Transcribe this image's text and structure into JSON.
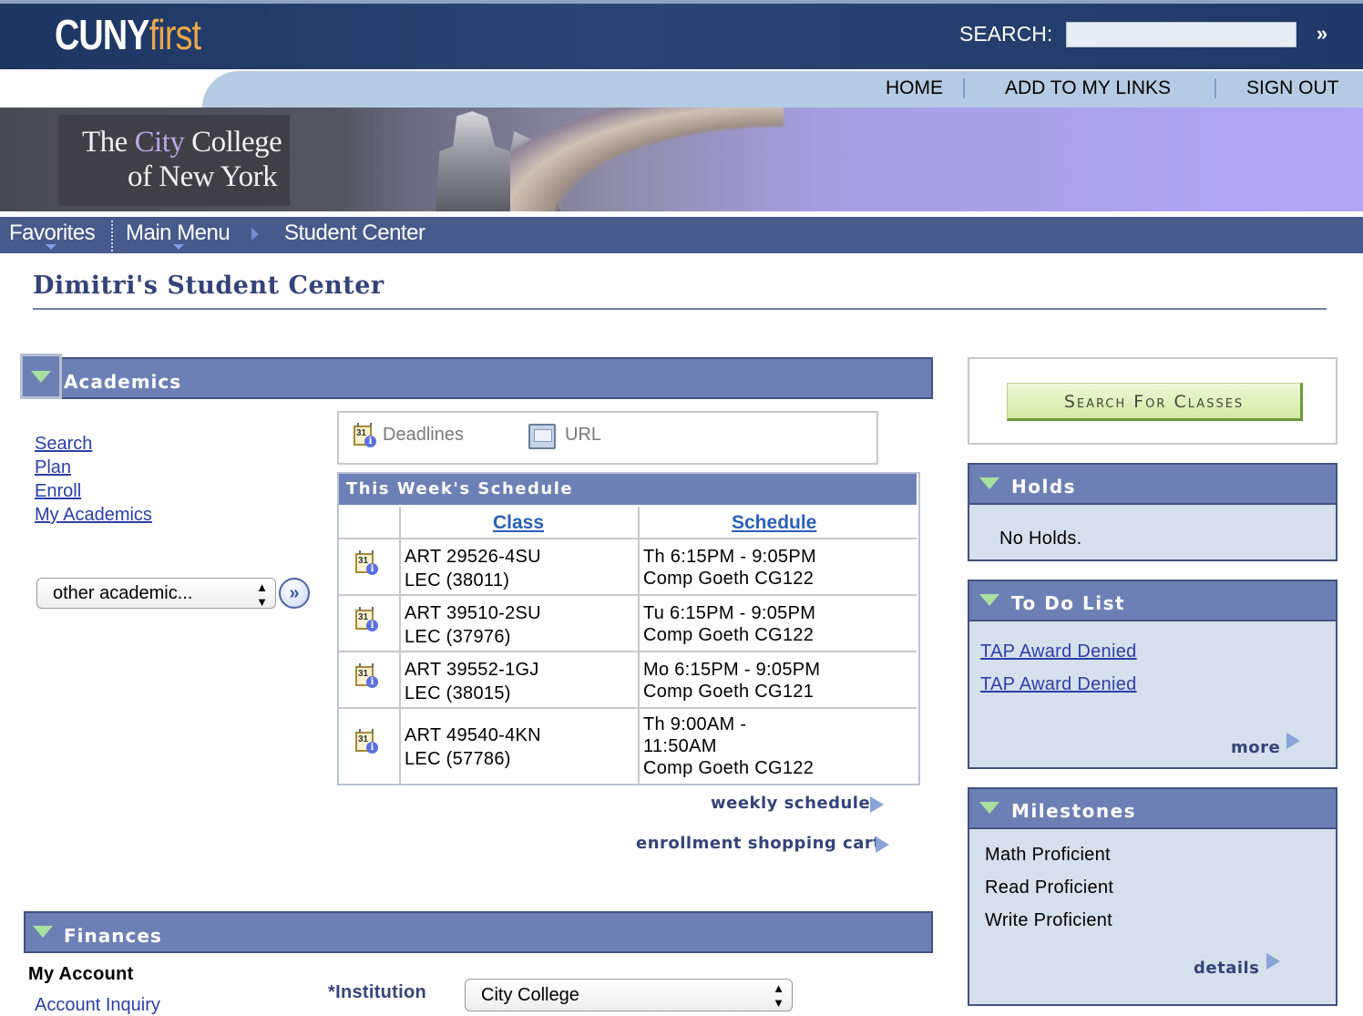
{
  "header": {
    "logo_part1": "CUNY",
    "logo_part2": "first",
    "search_label": "SEARCH:",
    "search_value": "",
    "search_go_glyph": "»",
    "links": [
      "HOME",
      "ADD TO MY LINKS",
      "SIGN OUT"
    ]
  },
  "banner": {
    "college_line1a": "The ",
    "college_line1b": "City",
    "college_line1c": " College",
    "college_line2": "of New York"
  },
  "nav": {
    "items": [
      "Favorites",
      "Main Menu",
      "Student Center"
    ]
  },
  "page": {
    "title": "Dimitri's Student Center"
  },
  "academics": {
    "title": "Academics",
    "links": [
      "Search",
      "Plan",
      "Enroll",
      "My Academics"
    ],
    "select_value": "other academic...",
    "go_glyph": "»",
    "deadlines_label": "Deadlines",
    "url_label": "URL",
    "schedule": {
      "title": "This Week's Schedule",
      "col_class": "Class",
      "col_schedule": "Schedule",
      "rows": [
        {
          "class1": "ART 29526-4SU",
          "class2": "LEC (38011)",
          "sched1": "Th 6:15PM - 9:05PM",
          "sched2": "Comp Goeth CG122",
          "sched3": ""
        },
        {
          "class1": "ART 39510-2SU",
          "class2": "LEC (37976)",
          "sched1": "Tu 6:15PM - 9:05PM",
          "sched2": "Comp Goeth CG122",
          "sched3": ""
        },
        {
          "class1": "ART 39552-1GJ",
          "class2": "LEC (38015)",
          "sched1": "Mo 6:15PM - 9:05PM",
          "sched2": "Comp Goeth CG121",
          "sched3": ""
        },
        {
          "class1": "ART 49540-4KN",
          "class2": "LEC (57786)",
          "sched1": "Th 9:00AM -",
          "sched2": "11:50AM",
          "sched3": "Comp Goeth CG122"
        }
      ]
    },
    "weekly_schedule": "weekly schedule",
    "shopping_cart": "enrollment shopping cart"
  },
  "finances": {
    "title": "Finances",
    "my_account": "My Account",
    "account_inquiry": "Account Inquiry",
    "institution_label": "*Institution",
    "institution_value": "City College"
  },
  "right": {
    "search_for_classes": "Search For Classes",
    "holds": {
      "title": "Holds",
      "text": "No Holds."
    },
    "todo": {
      "title": "To Do List",
      "items": [
        "TAP Award Denied",
        "TAP Award Denied"
      ],
      "more": "more"
    },
    "milestones": {
      "title": "Milestones",
      "items": [
        "Math Proficient",
        "Read Proficient",
        "Write Proficient"
      ],
      "details": "details"
    }
  },
  "colors": {
    "header_dark": "#1d3561",
    "section_blue": "#6d80b6",
    "link_blue": "#2a3fa8",
    "logo_orange": "#e9a84b",
    "button_green": "#d6eaa6"
  },
  "icons": [
    "search-go-icon",
    "calendar-info-icon",
    "url-icon",
    "expand-triangle-icon",
    "arrow-right-icon",
    "go-circle-icon"
  ]
}
